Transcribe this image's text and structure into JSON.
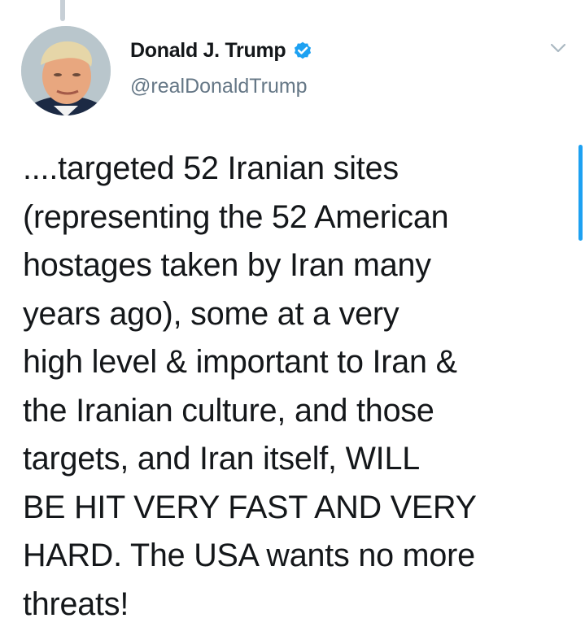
{
  "tweet": {
    "author": {
      "display_name": "Donald J. Trump",
      "handle": "@realDonaldTrump",
      "verified": true,
      "avatar_icon": "profile-photo"
    },
    "text_lines": [
      "....targeted 52 Iranian sites",
      "(representing the 52 American",
      "hostages taken by Iran many",
      "years ago), some at a very",
      "high level & important to Iran &",
      "the Iranian culture, and those",
      "targets, and Iran itself, WILL",
      "BE HIT VERY FAST AND VERY",
      "HARD. The USA wants no more",
      "threats!"
    ],
    "menu_icon": "chevron-down-icon"
  },
  "colors": {
    "text": "#14171a",
    "handle": "#657786",
    "verified_badge": "#1da1f2",
    "scroll_indicator": "#1da1f2"
  }
}
